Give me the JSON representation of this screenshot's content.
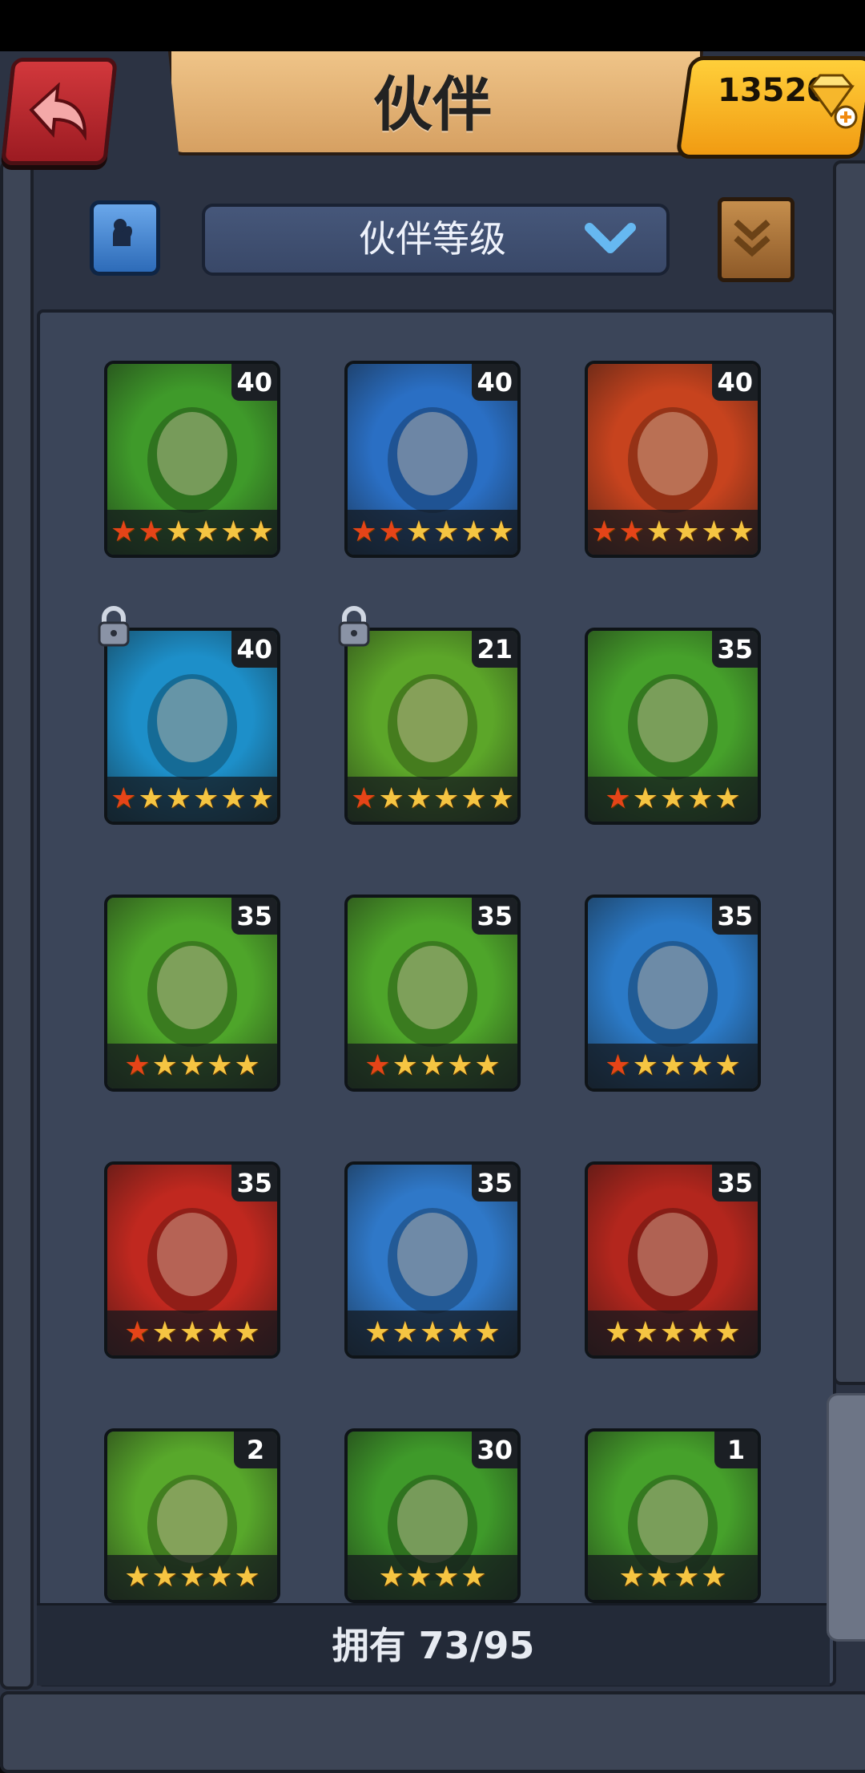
{
  "header": {
    "title": "伙伴",
    "gems": "13520"
  },
  "controls": {
    "sort_label": "伙伴等级"
  },
  "cards": [
    {
      "level": "40",
      "red": 2,
      "stars": 6,
      "bg": "#3f9a2a",
      "locked": false
    },
    {
      "level": "40",
      "red": 2,
      "stars": 6,
      "bg": "#2a6fc4",
      "locked": false
    },
    {
      "level": "40",
      "red": 2,
      "stars": 6,
      "bg": "#c7431e",
      "locked": false
    },
    {
      "level": "40",
      "red": 1,
      "stars": 6,
      "bg": "#1d8fc9",
      "locked": true
    },
    {
      "level": "21",
      "red": 1,
      "stars": 6,
      "bg": "#5ca629",
      "locked": true
    },
    {
      "level": "35",
      "red": 1,
      "stars": 5,
      "bg": "#46a12b",
      "locked": false
    },
    {
      "level": "35",
      "red": 1,
      "stars": 5,
      "bg": "#4ea52a",
      "locked": false
    },
    {
      "level": "35",
      "red": 1,
      "stars": 5,
      "bg": "#4ea52a",
      "locked": false
    },
    {
      "level": "35",
      "red": 1,
      "stars": 5,
      "bg": "#2b7ac7",
      "locked": false
    },
    {
      "level": "35",
      "red": 1,
      "stars": 5,
      "bg": "#c0281f",
      "locked": false
    },
    {
      "level": "35",
      "red": 0,
      "stars": 5,
      "bg": "#2f78c8",
      "locked": false
    },
    {
      "level": "35",
      "red": 0,
      "stars": 5,
      "bg": "#b3261d",
      "locked": false
    },
    {
      "level": "2",
      "red": 0,
      "stars": 5,
      "bg": "#58a82b",
      "locked": false
    },
    {
      "level": "30",
      "red": 0,
      "stars": 4,
      "bg": "#3f9a2a",
      "locked": false
    },
    {
      "level": "1",
      "red": 0,
      "stars": 4,
      "bg": "#46a12b",
      "locked": false
    }
  ],
  "footer": {
    "owned": "拥有 73/95"
  }
}
